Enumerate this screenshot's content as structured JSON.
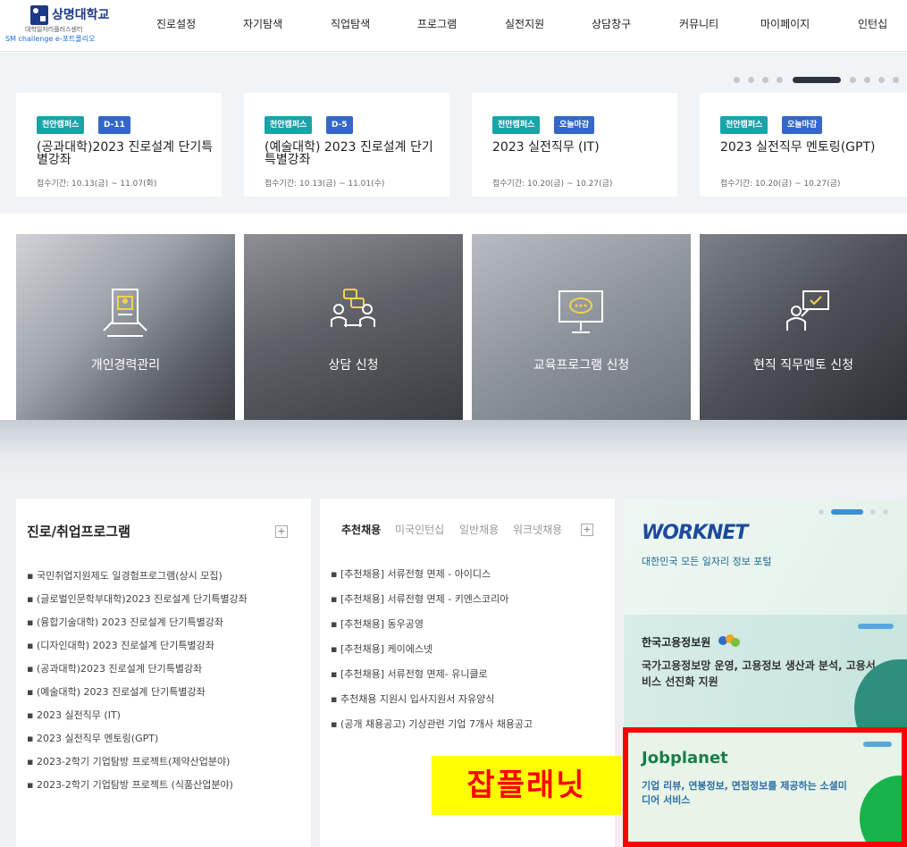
{
  "header": {
    "logo_name": "상명대학교",
    "logo_sub": "대학일자리플러스센터",
    "logo_sub2": "SM challenge e-포트폴리오",
    "nav": [
      "진로설정",
      "자기탐색",
      "직업탐색",
      "프로그램",
      "실전지원",
      "상담창구",
      "커뮤니티",
      "마이페이지",
      "인턴십"
    ]
  },
  "slider": {
    "dot_count": 10,
    "active_dot_index": 4,
    "cards": [
      {
        "campus": "천안캠퍼스",
        "badge": "D-11",
        "title": "(공과대학)2023 진로설계 단기특별강좌",
        "date": "접수기간: 10.13(금) ~ 11.07(화)"
      },
      {
        "campus": "천안캠퍼스",
        "badge": "D-5",
        "title": "(예술대학) 2023 진로설계 단기특별강좌",
        "date": "접수기간: 10.13(금) ~ 11.01(수)"
      },
      {
        "campus": "천안캠퍼스",
        "badge": "오늘마감",
        "title": "2023 실전직무 (IT)",
        "date": "접수기간: 10.20(금) ~ 10.27(금)"
      },
      {
        "campus": "천안캠퍼스",
        "badge": "오늘마감",
        "title": "2023 실전직무 멘토링(GPT)",
        "date": "접수기간: 10.20(금) ~ 10.27(금)"
      }
    ]
  },
  "tiles": [
    {
      "label": "개인경력관리",
      "icon": "id-card-icon"
    },
    {
      "label": "상담 신청",
      "icon": "counseling-icon"
    },
    {
      "label": "교육프로그램 신청",
      "icon": "presentation-chat-icon"
    },
    {
      "label": "현직 직무멘토 신청",
      "icon": "mentor-board-icon"
    }
  ],
  "program_panel": {
    "title": "진로/취업프로그램",
    "more": "+",
    "items": [
      "국민취업지원제도 일경험프로그램(상시 모집)",
      "(글로벌인문학부대학)2023 진로설계 단기특별강좌",
      "(융합기술대학) 2023 진로설계 단기특별강좌",
      "(디자인대학) 2023 진로설계 단기특별강좌",
      "(공과대학)2023 진로설계 단기특별강좌",
      "(예술대학) 2023 진로설계 단기특별강좌",
      "2023 실전직무 (IT)",
      "2023 실전직무 멘토링(GPT)",
      "2023-2학기 기업탐방 프로젝트(제약산업분야)",
      "2023-2학기 기업탐방 프로젝트 (식품산업분야)"
    ]
  },
  "jobs_panel": {
    "tabs": [
      "추천채용",
      "미국인턴십",
      "일반채용",
      "워크넷채용"
    ],
    "more": "+",
    "items": [
      "[추천채용] 서류전형 면제 - 아이디스",
      "[추천채용] 서류전형 면제 - 키엔스코리아",
      "[추천채용] 동우공영",
      "[추천채용] 케이에스넷",
      "[추천채용] 서류전형 면제- 유니클로",
      "추천채용 지원시 입사지원서 자유양식",
      "(공개 채용공고) 기상관련 기업 7개사 채용공고"
    ]
  },
  "banners": {
    "worknet": {
      "title": "WORKNET",
      "subtitle": "대한민국 모든 일자리 정보 포털"
    },
    "keis": {
      "name": "한국고용정보원",
      "desc": "국가고용정보망 운영, 고용정보 생산과 분석, 고용서비스 선진화 지원"
    },
    "jobplanet": {
      "title": "Jobplanet",
      "desc": "기업 리뷰, 연봉정보, 면접정보를 제공하는 소셜미디어 서비스"
    }
  },
  "annotation": {
    "label": "잡플래닛",
    "box_color": "#ff0000",
    "label_bg": "#ffff00"
  },
  "colors": {
    "badge_campus": "#1aa3a8",
    "badge_dday": "#3467c8",
    "brand": "#1d3a8a"
  }
}
